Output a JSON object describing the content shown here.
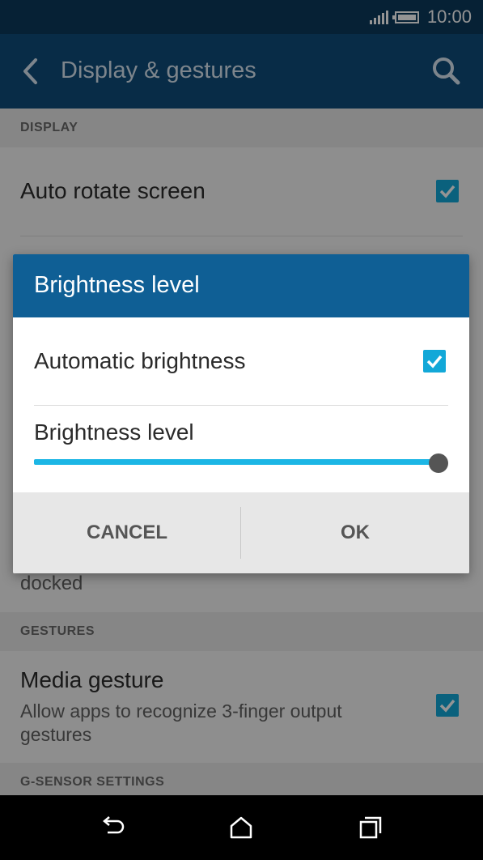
{
  "status_bar": {
    "time": "10:00"
  },
  "app_bar": {
    "title": "Display & gestures"
  },
  "sections": {
    "display": "DISPLAY",
    "gestures": "GESTURES",
    "gsensor": "G-SENSOR SETTINGS"
  },
  "settings": {
    "auto_rotate": {
      "label": "Auto rotate screen",
      "checked": true
    },
    "docked_partial": "docked",
    "media_gesture": {
      "label": "Media gesture",
      "description": "Allow apps to recognize 3-finger output gestures",
      "checked": true
    }
  },
  "dialog": {
    "title": "Brightness level",
    "automatic_brightness": {
      "label": "Automatic brightness",
      "checked": true
    },
    "brightness_label": "Brightness level",
    "brightness_value": 1.0,
    "cancel": "CANCEL",
    "ok": "OK"
  },
  "nav_icons": [
    "back-icon",
    "home-icon",
    "recents-icon"
  ],
  "colors": {
    "status_bar": "#0c3a5c",
    "app_bar": "#0f4c7a",
    "dialog_header": "#0f5f95",
    "accent": "#1cb6e5"
  }
}
